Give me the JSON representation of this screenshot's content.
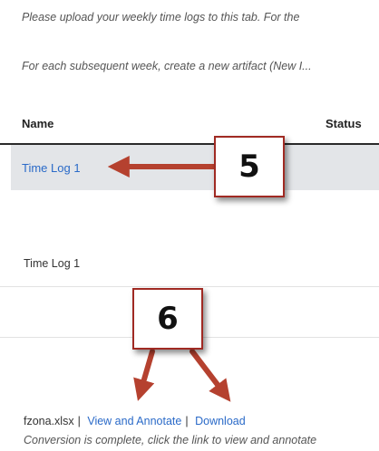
{
  "intro": {
    "line1": "Please upload your weekly time logs to this tab. For the",
    "line2": "For each subsequent week, create a new artifact (New I..."
  },
  "table": {
    "headers": {
      "name": "Name",
      "status": "Status"
    },
    "rows": [
      {
        "name": "Time Log 1"
      }
    ]
  },
  "detail": {
    "title": "Time Log 1",
    "attachment": {
      "filename": "fzona.xlsx",
      "separator": "|",
      "view_link": "View and Annotate",
      "download_link": "Download",
      "conversion_status": "Conversion is complete, click the link to view and annotate"
    }
  },
  "callouts": {
    "step5": "5",
    "step6": "6"
  },
  "colors": {
    "link": "#2a6ac8",
    "arrow": "#b5412f",
    "callout_border": "#a02a23",
    "selected_row": "#e3e5e8"
  }
}
